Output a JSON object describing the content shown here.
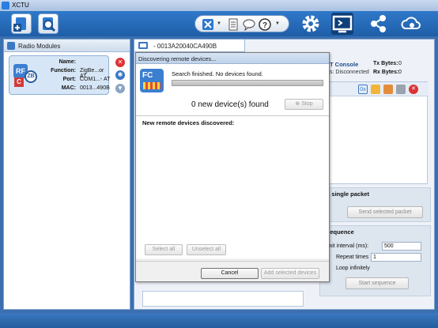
{
  "window": {
    "title": "XCTU"
  },
  "toolbar": {
    "items": [
      {
        "name": "add-device-button",
        "icon": "add-device-icon"
      },
      {
        "name": "discover-devices-button",
        "icon": "discover-icon"
      },
      {
        "name": "tools-button",
        "icon": "tools-icon"
      },
      {
        "name": "xctu-settings-button",
        "icon": "settings-list-icon"
      },
      {
        "name": "feedback-button",
        "icon": "speech-bubble-icon"
      },
      {
        "name": "help-button",
        "icon": "help-icon"
      },
      {
        "name": "configuration-mode-button",
        "icon": "gear-icon"
      },
      {
        "name": "consoles-mode-button",
        "icon": "terminal-icon"
      },
      {
        "name": "network-mode-button",
        "icon": "network-icon"
      },
      {
        "name": "cloud-mode-button",
        "icon": "cloud-gear-icon"
      }
    ]
  },
  "left_panel": {
    "title": "Radio Modules",
    "device": {
      "name_label": "Name:",
      "name_value": "",
      "function_label": "Function:",
      "function_value": "ZigBe...or AT",
      "port_label": "Port:",
      "port_value": "COM1...- AT",
      "mac_label": "MAC:",
      "mac_value": "0013...490B"
    }
  },
  "right_panel": {
    "tab_label": "- 0013A20040CA490B",
    "console": {
      "title": "T Console",
      "status": "s: Disconnected",
      "tx_label": "Tx Bytes:",
      "tx_value": "0",
      "rx_label": "Rx Bytes:",
      "rx_value": "0"
    },
    "single_packet": {
      "header": "l a single packet",
      "send_button": "Send selected packet"
    },
    "sequence": {
      "header": "l sequence",
      "interval_label": "nsmit interval (ms):",
      "interval_value": "500",
      "repeat_label": "Repeat times",
      "repeat_value": "1",
      "loop_label": "Loop infinitely",
      "start_button": "Start sequence"
    }
  },
  "dialog": {
    "title": "Discovering remote devices...",
    "message": "Search finished. No devices found.",
    "progress": 1.0,
    "found_text": "0 new device(s) found",
    "stop_button": "Stop",
    "list_header": "New remote devices discovered:",
    "select_all": "Select all",
    "unselect_all": "Unselect all",
    "cancel_button": "Cancel",
    "add_button": "Add selected devices"
  }
}
